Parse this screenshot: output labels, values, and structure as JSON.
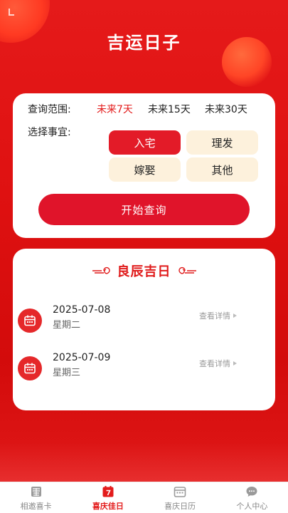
{
  "header": {
    "title": "吉运日子"
  },
  "query": {
    "range_label": "查询范围:",
    "range_options": [
      {
        "label": "未来7天",
        "active": true
      },
      {
        "label": "未来15天",
        "active": false
      },
      {
        "label": "未来30天",
        "active": false
      }
    ],
    "matter_label": "选择事宜:",
    "matters": [
      {
        "label": "入宅",
        "active": true
      },
      {
        "label": "理发",
        "active": false
      },
      {
        "label": "嫁娶",
        "active": false
      },
      {
        "label": "其他",
        "active": false
      }
    ],
    "button_label": "开始查询"
  },
  "results": {
    "title": "良辰吉日",
    "items": [
      {
        "date": "2025-07-08",
        "weekday": "星期二",
        "detail_label": "查看详情"
      },
      {
        "date": "2025-07-09",
        "weekday": "星期三",
        "detail_label": "查看详情"
      }
    ]
  },
  "tabbar": {
    "tabs": [
      {
        "label": "相邀喜卡",
        "icon": "double-happiness-icon",
        "active": false
      },
      {
        "label": "喜庆佳日",
        "icon": "calendar-7-icon",
        "active": true
      },
      {
        "label": "喜庆日历",
        "icon": "calendar-icon",
        "active": false
      },
      {
        "label": "个人中心",
        "icon": "chat-bubble-icon",
        "active": false
      }
    ]
  },
  "colors": {
    "primary_red": "#e31b1b",
    "tag_bg": "#fdf1dc"
  }
}
